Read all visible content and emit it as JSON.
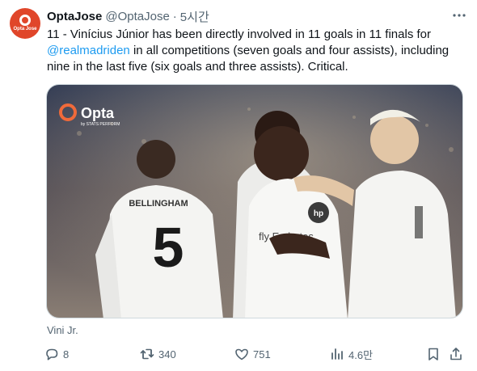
{
  "tweet": {
    "avatar_text": "Opta Jose",
    "display_name": "OptaJose",
    "handle": "@OptaJose",
    "separator": "·",
    "timestamp": "5시간",
    "text_before": "11 - Vinícius Júnior has been directly involved in 11 goals in 11 finals for ",
    "mention": "@realmadriden",
    "text_after": " in all competitions (seven goals and four assists), including nine in the last five (six goals and three assists). Critical.",
    "media": {
      "logo_text": "Opta",
      "logo_subtext": "by STATS PERFORM",
      "shirt_name": "BELLINGHAM",
      "shirt_number": "5",
      "sponsor_text": "fly Emirates"
    },
    "alt_text": "Vini Jr."
  },
  "actions": {
    "replies": "8",
    "reposts": "340",
    "likes": "751",
    "views": "4.6만"
  },
  "colors": {
    "text": "#0f1419",
    "secondary": "#536471",
    "link": "#1d9bf0",
    "brand": "#e0462a"
  }
}
